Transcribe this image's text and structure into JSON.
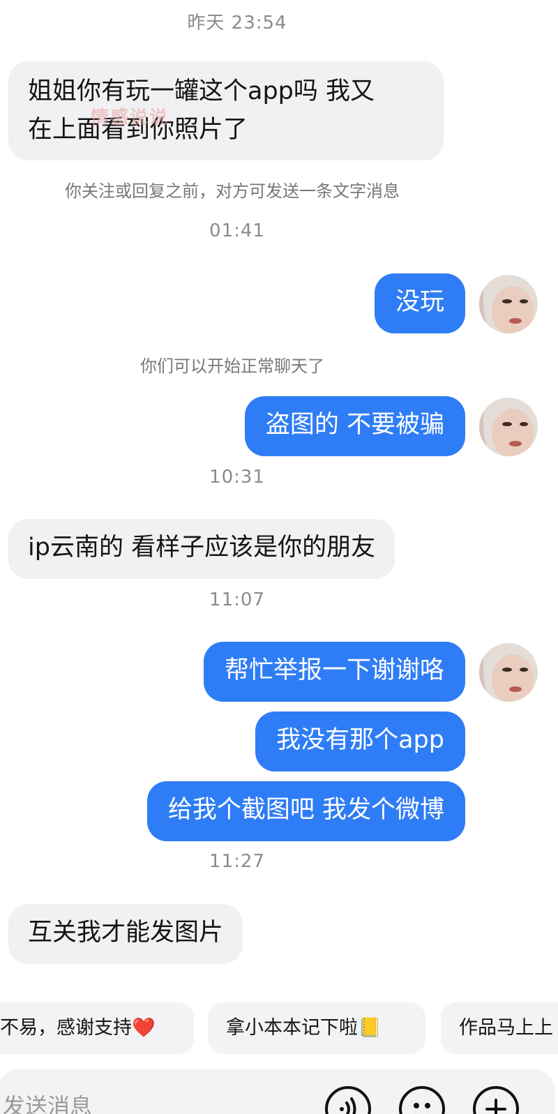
{
  "messages": {
    "ts1": "昨天 23:54",
    "m1_line1": "姐姐你有玩一罐这个app吗 我又",
    "m1_line2": "在上面看到你照片了",
    "sys1": "你关注或回复之前，对方可发送一条文字消息",
    "ts2": "01:41",
    "m2": "没玩",
    "sys2": "你们可以开始正常聊天了",
    "m3": "盗图的 不要被骗",
    "ts3": "10:31",
    "m4": "ip云南的 看样子应该是你的朋友",
    "ts4": "11:07",
    "m5": "帮忙举报一下谢谢咯",
    "m6": "我没有那个app",
    "m7": "给我个截图吧 我发个微博",
    "ts5": "11:27",
    "m8": "互关我才能发图片"
  },
  "quick_replies": [
    "不易，感谢支持❤️",
    "拿小本本记下啦📒",
    "作品马上上"
  ],
  "composer": {
    "placeholder": "发送消息",
    "icons": [
      "voice-icon",
      "emoji-icon",
      "plus-icon"
    ]
  },
  "watermark": "情感说说",
  "colors": {
    "outgoing_bubble": "#2f7df6",
    "incoming_bubble": "#f1f1f3",
    "timestamp": "#8b8b8b"
  }
}
